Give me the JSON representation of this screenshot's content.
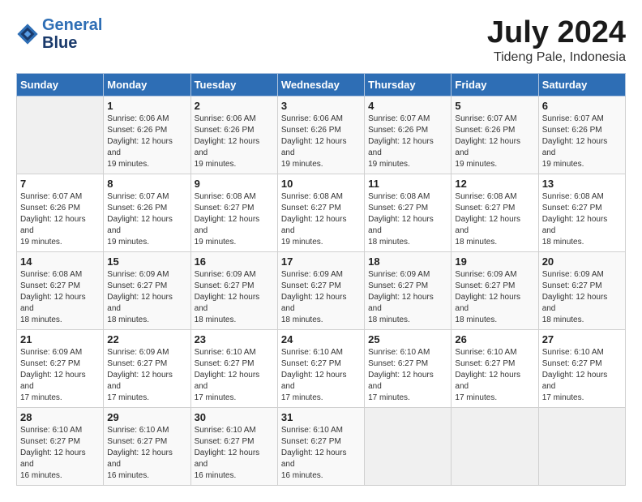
{
  "header": {
    "logo_line1": "General",
    "logo_line2": "Blue",
    "month_year": "July 2024",
    "location": "Tideng Pale, Indonesia"
  },
  "weekdays": [
    "Sunday",
    "Monday",
    "Tuesday",
    "Wednesday",
    "Thursday",
    "Friday",
    "Saturday"
  ],
  "weeks": [
    [
      {
        "day": "",
        "sunrise": "",
        "sunset": "",
        "daylight": ""
      },
      {
        "day": "1",
        "sunrise": "6:06 AM",
        "sunset": "6:26 PM",
        "daylight": "12 hours and 19 minutes."
      },
      {
        "day": "2",
        "sunrise": "6:06 AM",
        "sunset": "6:26 PM",
        "daylight": "12 hours and 19 minutes."
      },
      {
        "day": "3",
        "sunrise": "6:06 AM",
        "sunset": "6:26 PM",
        "daylight": "12 hours and 19 minutes."
      },
      {
        "day": "4",
        "sunrise": "6:07 AM",
        "sunset": "6:26 PM",
        "daylight": "12 hours and 19 minutes."
      },
      {
        "day": "5",
        "sunrise": "6:07 AM",
        "sunset": "6:26 PM",
        "daylight": "12 hours and 19 minutes."
      },
      {
        "day": "6",
        "sunrise": "6:07 AM",
        "sunset": "6:26 PM",
        "daylight": "12 hours and 19 minutes."
      }
    ],
    [
      {
        "day": "7",
        "sunrise": "6:07 AM",
        "sunset": "6:26 PM",
        "daylight": "12 hours and 19 minutes."
      },
      {
        "day": "8",
        "sunrise": "6:07 AM",
        "sunset": "6:26 PM",
        "daylight": "12 hours and 19 minutes."
      },
      {
        "day": "9",
        "sunrise": "6:08 AM",
        "sunset": "6:27 PM",
        "daylight": "12 hours and 19 minutes."
      },
      {
        "day": "10",
        "sunrise": "6:08 AM",
        "sunset": "6:27 PM",
        "daylight": "12 hours and 19 minutes."
      },
      {
        "day": "11",
        "sunrise": "6:08 AM",
        "sunset": "6:27 PM",
        "daylight": "12 hours and 18 minutes."
      },
      {
        "day": "12",
        "sunrise": "6:08 AM",
        "sunset": "6:27 PM",
        "daylight": "12 hours and 18 minutes."
      },
      {
        "day": "13",
        "sunrise": "6:08 AM",
        "sunset": "6:27 PM",
        "daylight": "12 hours and 18 minutes."
      }
    ],
    [
      {
        "day": "14",
        "sunrise": "6:08 AM",
        "sunset": "6:27 PM",
        "daylight": "12 hours and 18 minutes."
      },
      {
        "day": "15",
        "sunrise": "6:09 AM",
        "sunset": "6:27 PM",
        "daylight": "12 hours and 18 minutes."
      },
      {
        "day": "16",
        "sunrise": "6:09 AM",
        "sunset": "6:27 PM",
        "daylight": "12 hours and 18 minutes."
      },
      {
        "day": "17",
        "sunrise": "6:09 AM",
        "sunset": "6:27 PM",
        "daylight": "12 hours and 18 minutes."
      },
      {
        "day": "18",
        "sunrise": "6:09 AM",
        "sunset": "6:27 PM",
        "daylight": "12 hours and 18 minutes."
      },
      {
        "day": "19",
        "sunrise": "6:09 AM",
        "sunset": "6:27 PM",
        "daylight": "12 hours and 18 minutes."
      },
      {
        "day": "20",
        "sunrise": "6:09 AM",
        "sunset": "6:27 PM",
        "daylight": "12 hours and 18 minutes."
      }
    ],
    [
      {
        "day": "21",
        "sunrise": "6:09 AM",
        "sunset": "6:27 PM",
        "daylight": "12 hours and 17 minutes."
      },
      {
        "day": "22",
        "sunrise": "6:09 AM",
        "sunset": "6:27 PM",
        "daylight": "12 hours and 17 minutes."
      },
      {
        "day": "23",
        "sunrise": "6:10 AM",
        "sunset": "6:27 PM",
        "daylight": "12 hours and 17 minutes."
      },
      {
        "day": "24",
        "sunrise": "6:10 AM",
        "sunset": "6:27 PM",
        "daylight": "12 hours and 17 minutes."
      },
      {
        "day": "25",
        "sunrise": "6:10 AM",
        "sunset": "6:27 PM",
        "daylight": "12 hours and 17 minutes."
      },
      {
        "day": "26",
        "sunrise": "6:10 AM",
        "sunset": "6:27 PM",
        "daylight": "12 hours and 17 minutes."
      },
      {
        "day": "27",
        "sunrise": "6:10 AM",
        "sunset": "6:27 PM",
        "daylight": "12 hours and 17 minutes."
      }
    ],
    [
      {
        "day": "28",
        "sunrise": "6:10 AM",
        "sunset": "6:27 PM",
        "daylight": "12 hours and 16 minutes."
      },
      {
        "day": "29",
        "sunrise": "6:10 AM",
        "sunset": "6:27 PM",
        "daylight": "12 hours and 16 minutes."
      },
      {
        "day": "30",
        "sunrise": "6:10 AM",
        "sunset": "6:27 PM",
        "daylight": "12 hours and 16 minutes."
      },
      {
        "day": "31",
        "sunrise": "6:10 AM",
        "sunset": "6:27 PM",
        "daylight": "12 hours and 16 minutes."
      },
      {
        "day": "",
        "sunrise": "",
        "sunset": "",
        "daylight": ""
      },
      {
        "day": "",
        "sunrise": "",
        "sunset": "",
        "daylight": ""
      },
      {
        "day": "",
        "sunrise": "",
        "sunset": "",
        "daylight": ""
      }
    ]
  ],
  "labels": {
    "sunrise_prefix": "Sunrise: ",
    "sunset_prefix": "Sunset: ",
    "daylight_prefix": "Daylight: "
  }
}
